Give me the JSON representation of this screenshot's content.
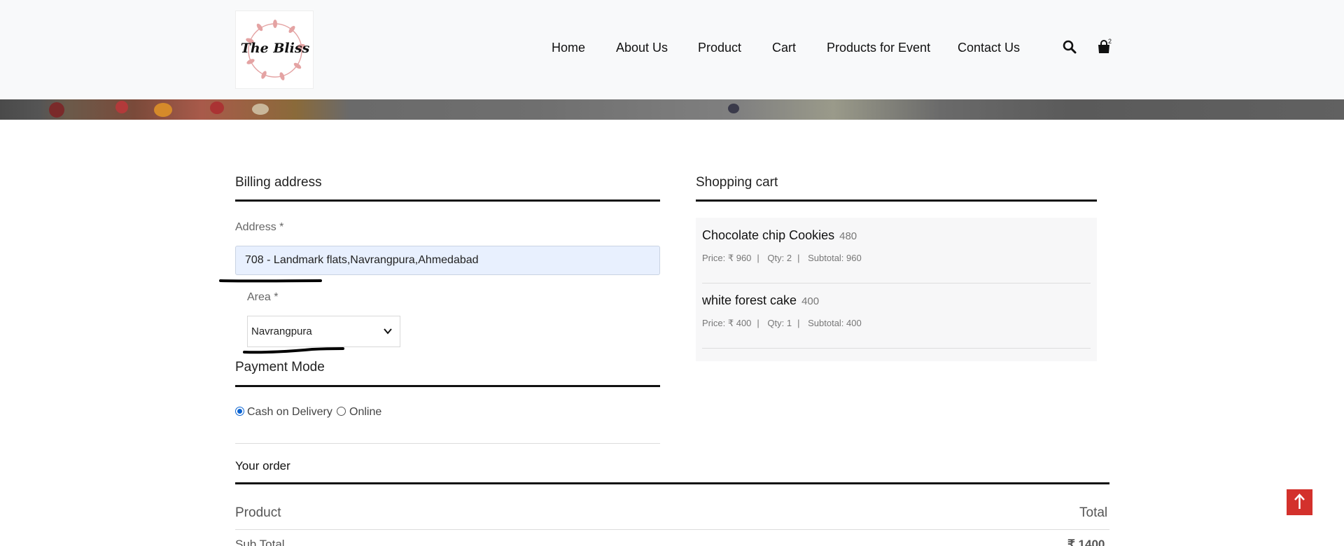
{
  "header": {
    "logo_text": "The Bliss",
    "nav": [
      "Home",
      "About Us",
      "Product",
      "Cart",
      "Products for Event",
      "Contact Us"
    ],
    "cart_count": "2"
  },
  "billing": {
    "title": "Billing address",
    "address_label": "Address *",
    "address_value": "708 - Landmark flats,Navrangpura,Ahmedabad",
    "area_label": "Area *",
    "area_value": "Navrangpura"
  },
  "payment": {
    "title": "Payment Mode",
    "options": [
      "Cash on Delivery",
      "Online"
    ],
    "selected": "Cash on Delivery"
  },
  "cart": {
    "title": "Shopping cart",
    "items": [
      {
        "name": "Chocolate chip Cookies",
        "unit_price": "480",
        "price": "Price: ₹ 960",
        "qty": "Qty: 2",
        "subtotal": "Subtotal: 960"
      },
      {
        "name": "white forest cake",
        "unit_price": "400",
        "price": "Price: ₹ 400",
        "qty": "Qty: 1",
        "subtotal": "Subtotal: 400"
      }
    ]
  },
  "order": {
    "title": "Your order",
    "col_product": "Product",
    "col_total": "Total",
    "subtotal_label": "Sub Total",
    "subtotal_value": "₹ 1400"
  },
  "colors": {
    "header_bg": "#f8f9fa",
    "autofill_bg": "#e8f0fe",
    "radio_accent": "#0b63d1",
    "to_top_button": "#d3312c"
  },
  "icons": [
    "search-icon",
    "shopping-bag-icon",
    "chevron-down-icon",
    "arrow-up-icon"
  ]
}
